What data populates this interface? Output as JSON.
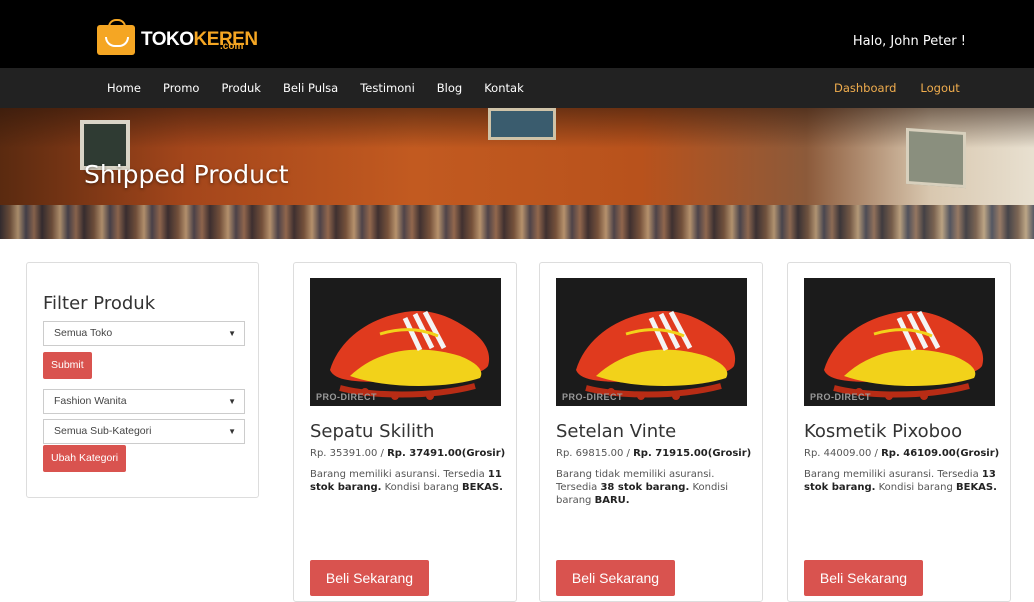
{
  "header": {
    "logo_main_white": "TOKO",
    "logo_main_orange": "KEREN",
    "logo_sub": ".com",
    "greeting": "Halo, John Peter !"
  },
  "nav": {
    "items": [
      "Home",
      "Promo",
      "Produk",
      "Beli Pulsa",
      "Testimoni",
      "Blog",
      "Kontak"
    ],
    "right": [
      "Dashboard",
      "Logout"
    ]
  },
  "hero": {
    "title": "Shipped Product"
  },
  "filter": {
    "title": "Filter Produk",
    "toko_select": "Semua Toko",
    "submit_label": "Submit",
    "kategori_select": "Fashion Wanita",
    "subkategori_select": "Semua Sub-Kategori",
    "ubah_label": "Ubah Kategori"
  },
  "products": [
    {
      "name": "Sepatu Skilith",
      "price": "Rp. 35391.00 / ",
      "grosir": "Rp. 37491.00(Grosir)",
      "desc_pre": "Barang memiliki asuransi. Tersedia ",
      "stock": "11 stok barang.",
      "desc_mid": " Kondisi barang ",
      "condition": "BEKAS.",
      "watermark": "PRO-DIRECT",
      "buy_label": "Beli Sekarang"
    },
    {
      "name": "Setelan Vinte",
      "price": "Rp. 69815.00 / ",
      "grosir": "Rp. 71915.00(Grosir)",
      "desc_pre": "Barang tidak memiliki asuransi. Tersedia ",
      "stock": "38 stok barang.",
      "desc_mid": " Kondisi barang ",
      "condition": "BARU.",
      "watermark": "PRO-DIRECT",
      "buy_label": "Beli Sekarang"
    },
    {
      "name": "Kosmetik Pixoboo",
      "price": "Rp. 44009.00 / ",
      "grosir": "Rp. 46109.00(Grosir)",
      "desc_pre": "Barang memiliki asuransi. Tersedia ",
      "stock": "13 stok barang.",
      "desc_mid": " Kondisi barang ",
      "condition": "BEKAS.",
      "watermark": "PRO-DIRECT",
      "buy_label": "Beli Sekarang"
    }
  ],
  "colors": {
    "accent_red": "#d9534f",
    "nav_highlight": "#f0ad4e",
    "topbar": "#000000",
    "navbar": "#222222"
  }
}
